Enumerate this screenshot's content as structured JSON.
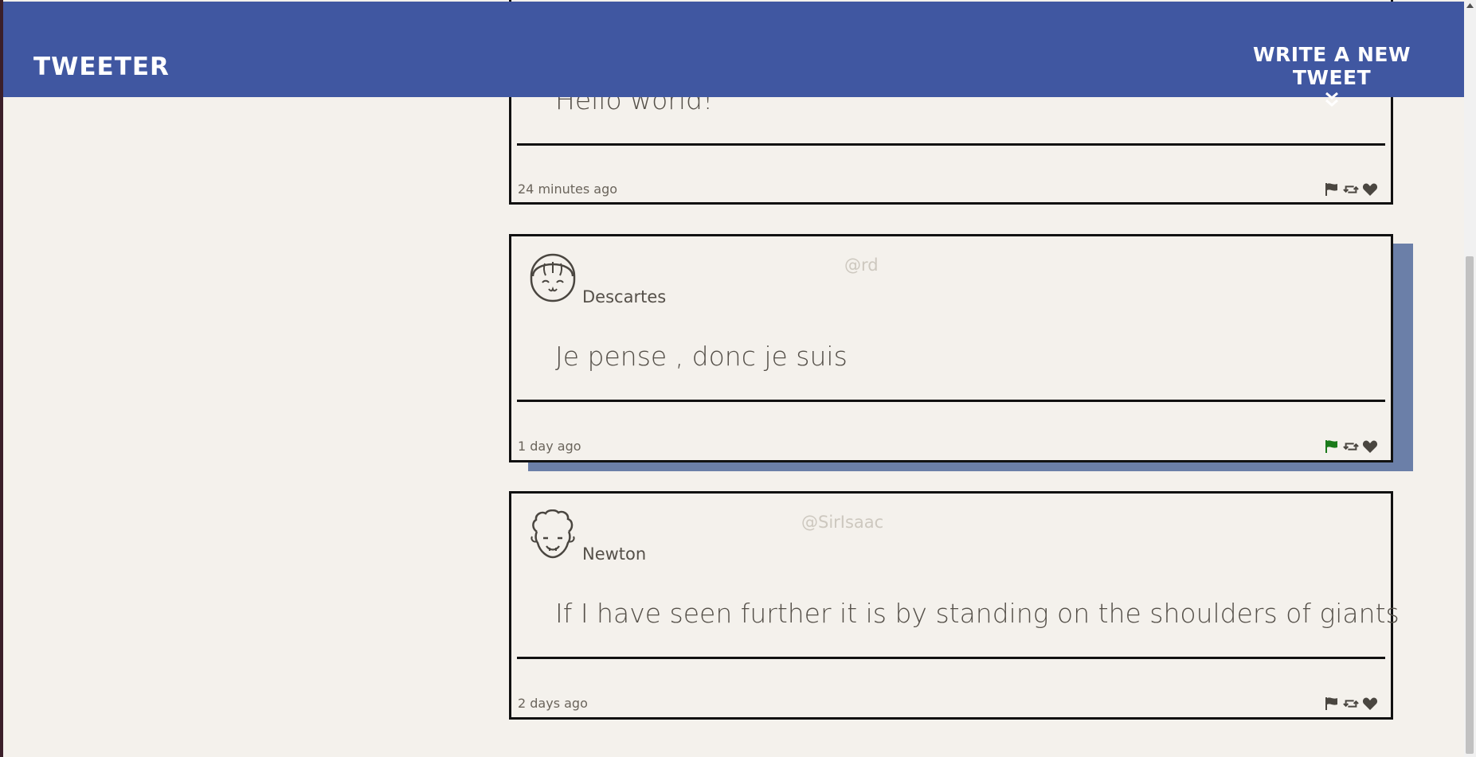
{
  "header": {
    "brand": "TWEETER",
    "compose_label": "WRITE A NEW TWEET",
    "compose_icon": "double-chevron-down-icon",
    "brand_color": "#4057a1"
  },
  "tweets": [
    {
      "display_name": "",
      "handle": "",
      "content": "Hello world!",
      "timestamp": "24 minutes ago",
      "flagged": false
    },
    {
      "display_name": "Descartes",
      "handle": "@rd",
      "avatar_icon": "girl-avatar-icon",
      "content": "Je pense , donc je suis",
      "timestamp": "1 day ago",
      "flagged": true,
      "highlighted": true
    },
    {
      "display_name": "Newton",
      "handle": "@SirIsaac",
      "avatar_icon": "curly-hair-avatar-icon",
      "content": "If I have seen further it is by standing on the shoulders of giants",
      "timestamp": "2 days ago",
      "flagged": false
    }
  ],
  "colors": {
    "flag_active": "#1a7a1a",
    "icon_default": "#4a4640",
    "hover_shadow": "#6b7fa8",
    "background": "#f4f1ec"
  }
}
